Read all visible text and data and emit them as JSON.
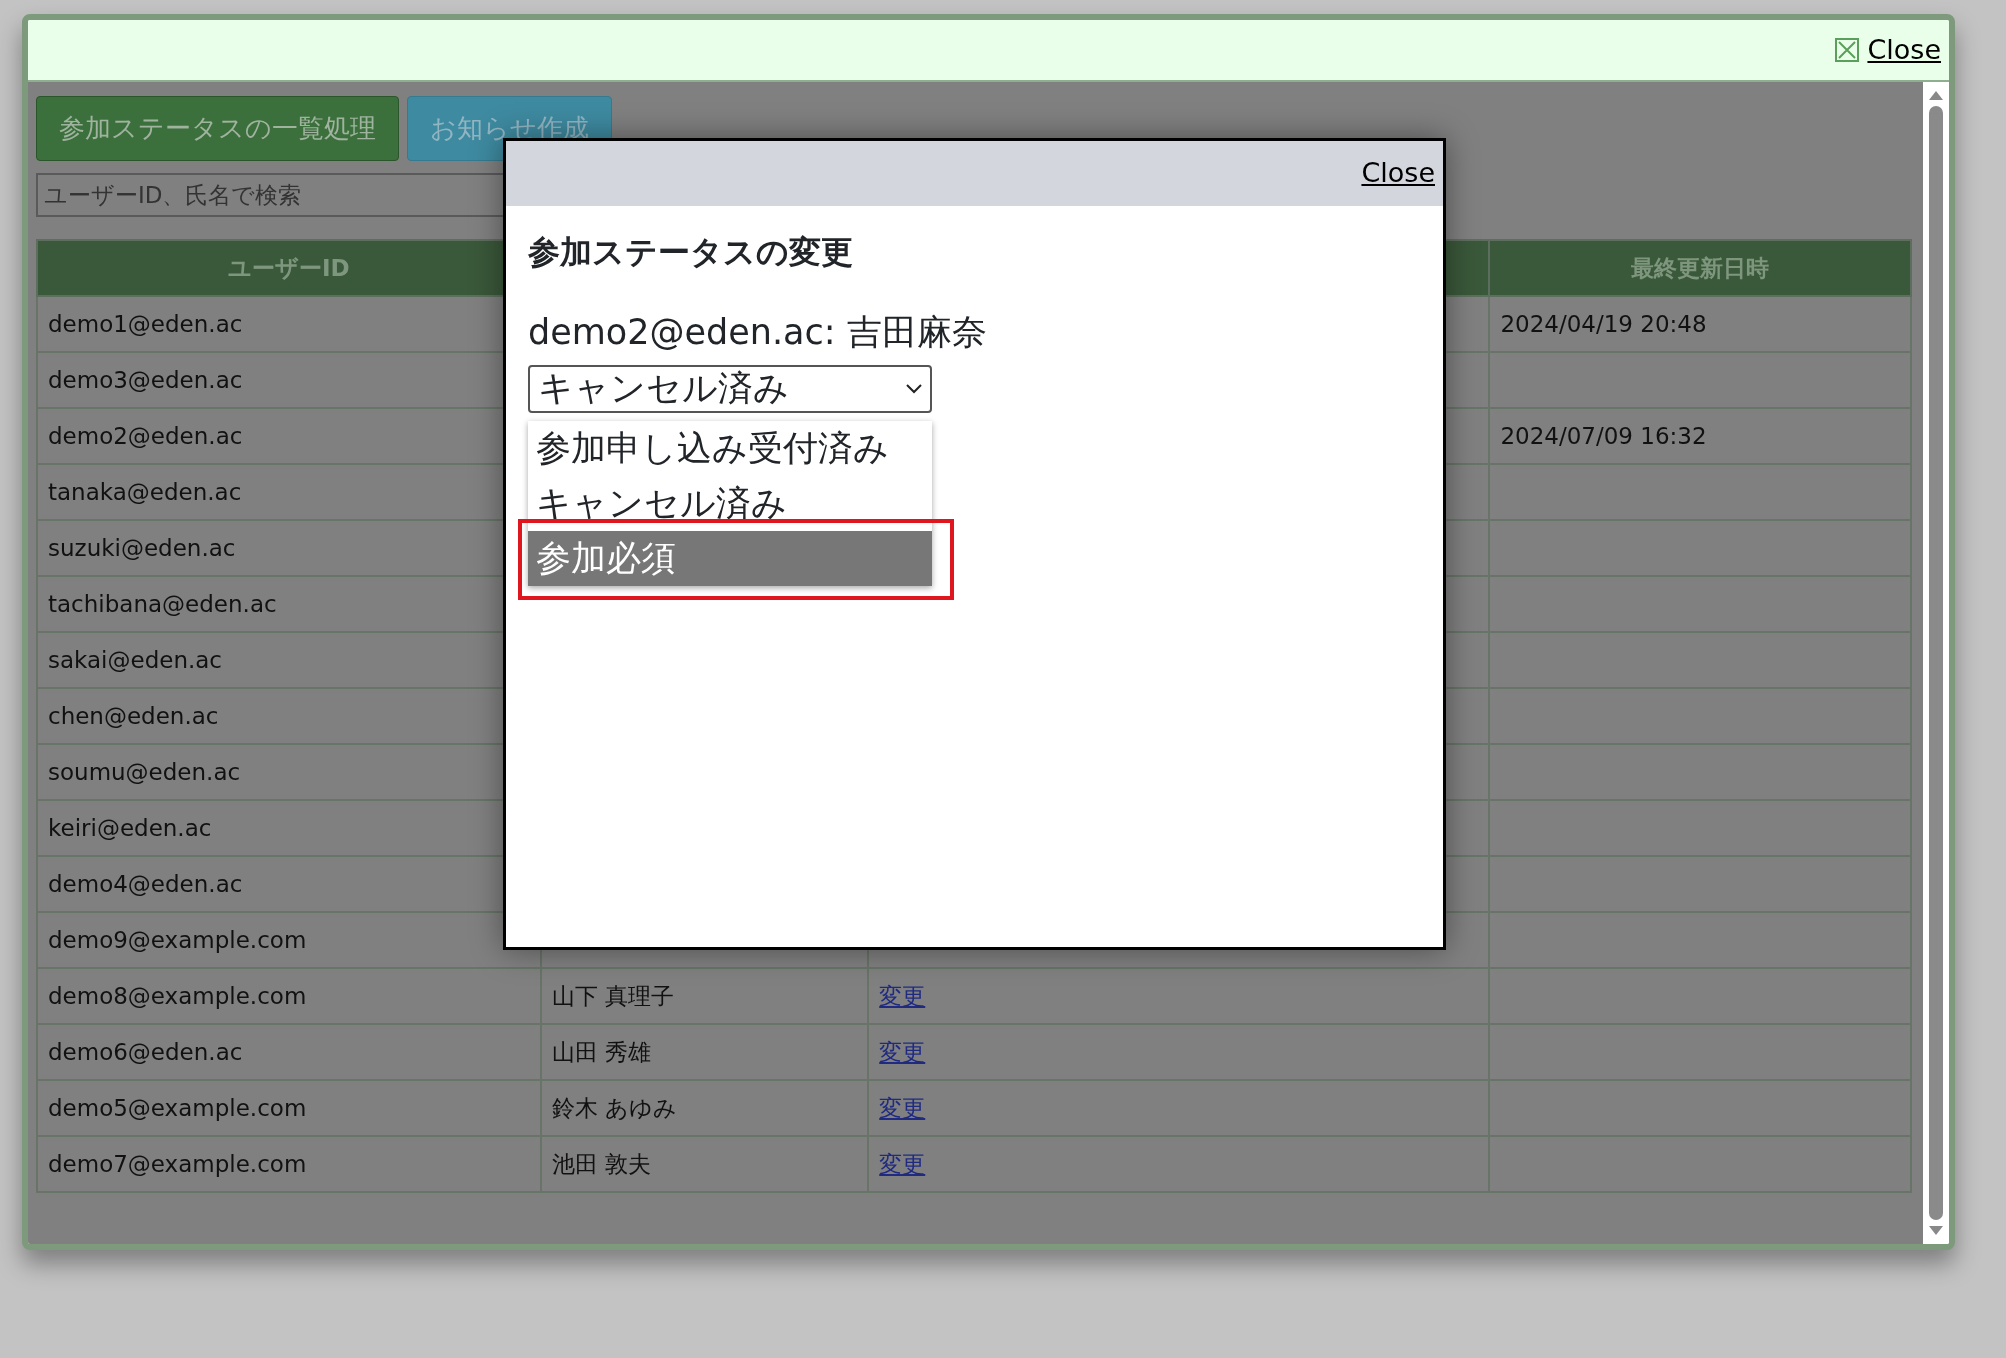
{
  "window": {
    "close_label": "Close"
  },
  "toolbar": {
    "buttons": [
      {
        "label": "参加ステータスの一覧処理",
        "kind": "primary"
      },
      {
        "label": "お知らせ作成",
        "kind": "info"
      }
    ]
  },
  "search": {
    "placeholder": "ユーザーID、氏名で検索"
  },
  "table": {
    "columns": [
      {
        "header": "ユーザーID"
      },
      {},
      {},
      {
        "header": "最終更新日時"
      }
    ],
    "rows": [
      {
        "user_id": "demo1@eden.ac",
        "updated": "2024/04/19 20:48"
      },
      {
        "user_id": "demo3@eden.ac"
      },
      {
        "user_id": "demo2@eden.ac",
        "updated": "2024/07/09 16:32"
      },
      {
        "user_id": "tanaka@eden.ac"
      },
      {
        "user_id": "suzuki@eden.ac"
      },
      {
        "user_id": "tachibana@eden.ac"
      },
      {
        "user_id": "sakai@eden.ac"
      },
      {
        "user_id": "chen@eden.ac"
      },
      {
        "user_id": "soumu@eden.ac"
      },
      {
        "user_id": "keiri@eden.ac"
      },
      {
        "user_id": "demo4@eden.ac"
      },
      {
        "user_id": "demo9@example.com"
      },
      {
        "user_id": "demo8@example.com",
        "name": "山下 真理子",
        "action": "変更"
      },
      {
        "user_id": "demo6@eden.ac",
        "name": "山田 秀雄",
        "action": "変更"
      },
      {
        "user_id": "demo5@example.com",
        "name": "鈴木 あゆみ",
        "action": "変更"
      },
      {
        "user_id": "demo7@example.com",
        "name": "池田 敦夫",
        "action": "変更"
      }
    ]
  },
  "dialog": {
    "close_label": "Close",
    "title": "参加ステータスの変更",
    "user": "demo2@eden.ac: 吉田麻奈",
    "select": {
      "value": "キャンセル済み",
      "expanded": true,
      "options": [
        {
          "label": "参加申し込み受付済み",
          "highlighted": false,
          "marked": false
        },
        {
          "label": "キャンセル済み",
          "highlighted": false,
          "marked": false
        },
        {
          "label": "参加必須",
          "highlighted": true,
          "marked": true
        }
      ]
    }
  }
}
